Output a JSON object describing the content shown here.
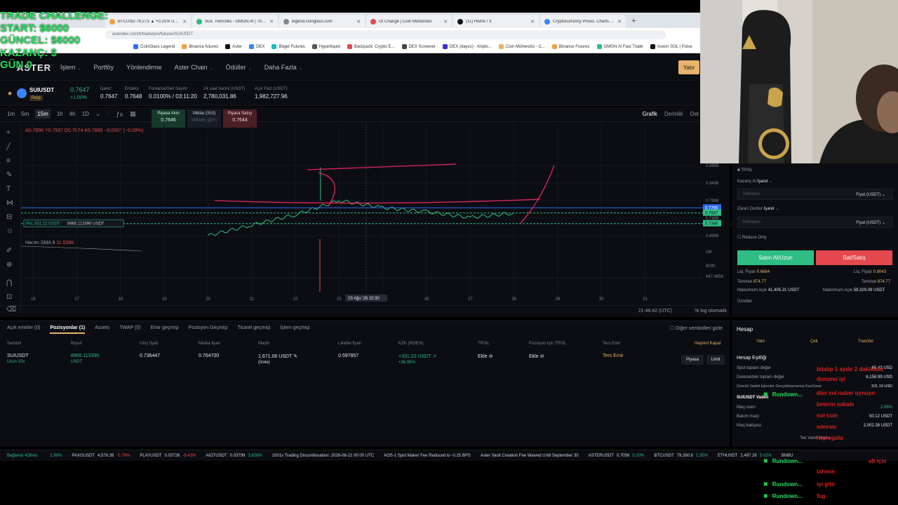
{
  "overlay": {
    "line1": "TRADE CHALLENGE:",
    "line2": "START: $6000",
    "line3": "GÜNCEL: $6000",
    "line4": "KAZANÇ: $",
    "line5": "GÜN 0"
  },
  "browser": {
    "tabs": [
      {
        "title": "BTCUSD 79.273 ▲ +0.31% Unn...",
        "color": "#f2a03d"
      },
      {
        "title": "SOL Trenches - GMGN.AI | The...",
        "color": "#2ebd85"
      },
      {
        "title": "legend.coinglass.com",
        "color": "#888888"
      },
      {
        "title": "OI Change | Coin Mühendisi",
        "color": "#e5484d"
      },
      {
        "title": "(11) Home / X",
        "color": "#111111"
      },
      {
        "title": "Cryptocurrency Prices, Charts A...",
        "color": "#3b86f7"
      }
    ],
    "new_tab": "+",
    "url": "asterdex.com/tr/trade/pro/futures/SUIUSDT",
    "bookmarks": [
      "CoinGlass Legend",
      "Binance futures",
      "Aster",
      "DEX",
      "Bitget Futures",
      "Hyperliquid",
      "Backpack: Crypto E...",
      "DEX Screener",
      "DEX (dayıcı) - Kripto...",
      "Coin Mühendisi - C...",
      "Binance Futures",
      "GMGN AI Fast Trade",
      "Axiom SOL | Pulse"
    ]
  },
  "header": {
    "logo": "ASTER",
    "nav": [
      {
        "label": "İşlem",
        "chev": "⌄"
      },
      {
        "label": "Portföy",
        "chev": ""
      },
      {
        "label": "Yönlendirme",
        "chev": ""
      },
      {
        "label": "Aster Chain",
        "chev": "⌄"
      },
      {
        "label": "Ödüller",
        "chev": "⌄"
      },
      {
        "label": "Daha Fazla",
        "chev": "⌄"
      }
    ],
    "deposit": "Yatır"
  },
  "ticker": {
    "pair": "SUIUSDT",
    "type": "Perp",
    "price": "0.7647",
    "change": "+1.00%",
    "stats": [
      {
        "label": "İşaret",
        "value": "0.7647"
      },
      {
        "label": "Endeks",
        "value": "0.7648"
      },
      {
        "label": "Fonlama/Geri Sayım",
        "value": "0.0100% / 03:11:20"
      },
      {
        "label": "24 saat hacmi (USDT)",
        "value": "2,780,031.86"
      },
      {
        "label": "Açık Faiz (USDT)",
        "value": "1,982,727.96"
      }
    ]
  },
  "chart_toolbar": {
    "timeframes": [
      "1m",
      "5m",
      "15m",
      "1h",
      "4h",
      "1D"
    ],
    "active": "15m",
    "views": [
      "Grafik",
      "Derinlik",
      "Det"
    ],
    "active_view": "Grafik"
  },
  "order_panel": {
    "buy_label": "Piyasa Alım",
    "buy_price": "0.7646",
    "qty_label": "Miktar (SUI)",
    "qty_placeholder": "Miktarı girin",
    "sell_label": "Piyasa Satışı",
    "sell_price": "0.7644"
  },
  "chart_data": {
    "type": "line",
    "ohlc_text": "A0.7896  Y0.7937  D0.7874  K0.7893  −0.0007 (−0.09%)",
    "volume_label": "Hacim SMA 9",
    "volume_value": "11.538K",
    "x_ticks": [
      "16",
      "17",
      "18",
      "19",
      "20",
      "21",
      "22",
      "23",
      "25",
      "26",
      "27",
      "28",
      "29",
      "30",
      "31"
    ],
    "y_ticks": [
      "0.8999",
      "0.8499",
      "0.7999",
      "0.7499",
      "0.6999"
    ],
    "current_price": "0.7795",
    "price_tags": [
      "0.7647",
      "0.7346"
    ],
    "vol_ticks": [
      "1M",
      "800K",
      "647.485K"
    ],
    "crosshair_label": "23 Ağu '26   15:30",
    "position_label": "PnL 331.22 USDT",
    "position_size_label": "8965.113390 USDT",
    "series": [
      {
        "x": [
          "16",
          "17",
          "18",
          "19",
          "20",
          "21",
          "22",
          "23",
          "25",
          "26",
          "27",
          "28"
        ],
        "y": [
          null,
          null,
          null,
          null,
          0.7,
          0.73,
          0.76,
          0.8,
          0.78,
          0.768,
          0.752,
          0.764
        ]
      }
    ],
    "grid": true
  },
  "chart_bottom": {
    "clock": "21:48:42 (UTC)",
    "options": "%   log   otomatik"
  },
  "order_form": {
    "tpsl": "TP/SL",
    "tp_label": "Kazanç Al",
    "tp_trigger": "İşaret",
    "tp_placeholder": "Tetikleyici",
    "tp_unit": "Fiyat (USDT)",
    "sl_label": "Zararı Durdur",
    "sl_trigger": "İşaret",
    "sl_placeholder": "Tetikleyici",
    "sl_unit": "Fiyat (USDT)",
    "reduce_only": "Reduce Only",
    "buy": "Satın Al/Uzun",
    "sell": "Sat/Satış",
    "buy_liq_label": "Liq. Fiyatı",
    "buy_liq": "0.6664",
    "sell_liq_label": "Liq. Fiyatı",
    "sell_liq": "0.8043",
    "buy_margin_label": "Teminat",
    "buy_margin": "874.77",
    "sell_margin_label": "Teminat",
    "sell_margin": "874.77",
    "buy_max_label": "Maksimum Açık",
    "buy_max": "41,405.21 USDT",
    "sell_max_label": "Maksimum Açık",
    "sell_max": "59,329.09 USDT",
    "fees": "Ücretler"
  },
  "positions": {
    "tabs": [
      "Açık emirler (0)",
      "Pozisyonlar (1)",
      "Assets",
      "TWAP (0)",
      "Emir geçmişi",
      "Pozisyon Geçmişi",
      "Ticaret geçmişi",
      "İşlem geçmişi"
    ],
    "active_tab": "Pozisyonlar (1)",
    "hide_other": "Diğer sembolleri gizle",
    "columns": [
      "Sembol",
      "Boyut",
      "Giriş fiyatı",
      "Marka fiyatı",
      "Marjin",
      "Likidite fiyatı",
      "KZK (ROE%)",
      "TP/SL",
      "Pozisyon için TP/SL",
      "Ters Emir",
      "Hepsini Kapat"
    ],
    "row": {
      "symbol": "SUIUSDT",
      "side": "Uzun 10x",
      "size": "8965.113390",
      "size_unit": "USDT",
      "entry": "0.736447",
      "mark": "0.764700",
      "margin": "1,671.06 USDT",
      "margin_mode": "(İzole)",
      "liq": "0.597857",
      "pnl": "+331.22 USDT",
      "roe": "+36.95%",
      "tpsl": "Ekle",
      "pos_tpsl": "Ekle",
      "reverse": "Ters Emir",
      "market": "Piyasa",
      "limit": "Limit"
    }
  },
  "account": {
    "title": "Hesap",
    "deposit": "Yatır",
    "withdraw": "Çek",
    "transfer": "Transfer",
    "equity": "Hesap Eşitliği",
    "rows": [
      {
        "label": "Spot toplam değer",
        "value": "65.43 USD"
      },
      {
        "label": "Gelecekteki toplam değer",
        "value": "6,158.99 USD"
      },
      {
        "label": "Sürekli Vadeli İşlemler Gerçekleşmemiş Kar/Zarar",
        "value": "331.19 USD"
      },
      {
        "label": "SUIUSDT Vadeli",
        "value": ""
      },
      {
        "label": "Marj oranı",
        "value": "2.96%"
      },
      {
        "label": "Bakım marjı",
        "value": "50.12 USDT"
      },
      {
        "label": "Marj bakiyesi",
        "value": "2,002.28 USDT"
      }
    ],
    "footer": "Tek Varlık Modu"
  },
  "bottom_ticker": [
    {
      "sym": "Bağlandı 428ms",
      "price": "",
      "chg": "",
      "color": "#2ebd85"
    },
    {
      "sym": "",
      "price": "",
      "chg": "2.90%",
      "color": "#2ebd85"
    },
    {
      "sym": "PAXGUSDT",
      "price": "4,578.39",
      "chg": "-0.78%",
      "color": "#e5484d"
    },
    {
      "sym": "PLAYUSDT",
      "price": "0.03726",
      "chg": "-6.43%",
      "color": "#e5484d"
    },
    {
      "sym": "AIOTUSDT",
      "price": "0.03799",
      "chg": "3.826%",
      "color": "#2ebd85"
    },
    {
      "sym": "1001x Trading Discontinuation: 2026-08-21 00:00 UTC",
      "price": "",
      "chg": "",
      "color": "#cfd3dc"
    },
    {
      "sym": "AOS-1 Spot Maker Fee Reduced to -0.25 BPS",
      "price": "",
      "chg": "",
      "color": "#cfd3dc"
    },
    {
      "sym": "Aster Vault Creation Fee Waived Until September 30",
      "price": "",
      "chg": "",
      "color": "#cfd3dc"
    },
    {
      "sym": "ASTERUSDT",
      "price": "0.7056",
      "chg": "0.20%",
      "color": "#2ebd85"
    },
    {
      "sym": "BTCUSDT",
      "price": "79,260.8",
      "chg": "1.35%",
      "color": "#2ebd85"
    },
    {
      "sym": "ETHUSDT",
      "price": "2,497.26",
      "chg": "5.02%",
      "color": "#2ebd85"
    },
    {
      "sym": "BNBU",
      "price": "",
      "chg": "",
      "color": "#cfd3dc"
    }
  ],
  "chat": {
    "user": "Rundown...",
    "messages": [
      "bitalıp 1 aydır 2 dakikada",
      "durumu iyi",
      "dün sol naber oynuyo",
      "beterin sakalıı",
      "sol coin",
      "sonrası",
      "hep egolu",
      "tahmin",
      "alt için",
      "iyi gitti",
      "füg"
    ]
  }
}
